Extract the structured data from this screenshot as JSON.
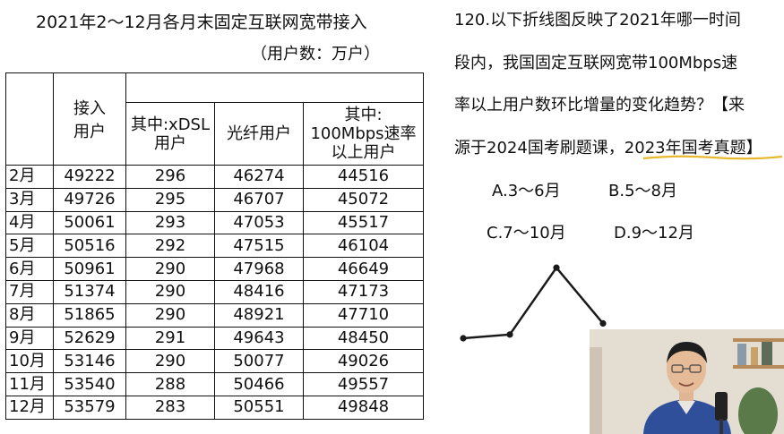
{
  "table": {
    "title": "2021年2～12月各月末固定互联网宽带接入",
    "unit": "（用户数：万户）",
    "headers": {
      "access": [
        "接入",
        "用户"
      ],
      "xdsl": [
        "其中:xDSL",
        "用户"
      ],
      "fiber": "光纤用户",
      "speed": [
        "其中:",
        "100Mbps速率",
        "以上用户"
      ]
    },
    "rows": [
      {
        "month": "2月",
        "access": "49222",
        "xdsl": "296",
        "fiber": "46274",
        "speed": "44516"
      },
      {
        "month": "3月",
        "access": "49726",
        "xdsl": "295",
        "fiber": "46707",
        "speed": "45072"
      },
      {
        "month": "4月",
        "access": "50061",
        "xdsl": "293",
        "fiber": "47053",
        "speed": "45517"
      },
      {
        "month": "5月",
        "access": "50516",
        "xdsl": "292",
        "fiber": "47515",
        "speed": "46104"
      },
      {
        "month": "6月",
        "access": "50961",
        "xdsl": "290",
        "fiber": "47968",
        "speed": "46649"
      },
      {
        "month": "7月",
        "access": "51374",
        "xdsl": "290",
        "fiber": "48416",
        "speed": "47173"
      },
      {
        "month": "8月",
        "access": "51865",
        "xdsl": "290",
        "fiber": "48921",
        "speed": "47710"
      },
      {
        "month": "9月",
        "access": "52629",
        "xdsl": "291",
        "fiber": "49643",
        "speed": "48450"
      },
      {
        "month": "10月",
        "access": "53146",
        "xdsl": "290",
        "fiber": "50077",
        "speed": "49026"
      },
      {
        "month": "11月",
        "access": "53540",
        "xdsl": "288",
        "fiber": "50466",
        "speed": "49557"
      },
      {
        "month": "12月",
        "access": "53579",
        "xdsl": "283",
        "fiber": "50551",
        "speed": "49848"
      }
    ]
  },
  "question": {
    "lines": [
      "120.以下折线图反映了2021年哪一时间",
      "段内，我国固定互联网宽带100Mbps速",
      "率以上用户数环比增量的变化趋势？【来",
      "源于2024国考刷题课，2023年国考真题】"
    ],
    "options": {
      "A": "A.3～6月",
      "B": "B.5～8月",
      "C": "C.7～10月",
      "D": "D.9～12月"
    }
  },
  "chart_data": {
    "type": "line",
    "note_values": "relative shape only; no axes or labels shown",
    "values": [
      0.0,
      0.05,
      0.95,
      0.2
    ]
  },
  "colors": {
    "text": "#111111",
    "underline": "#e8b830",
    "chart": "#1a1a1a",
    "inset_shirt": "#2f4f9a"
  }
}
